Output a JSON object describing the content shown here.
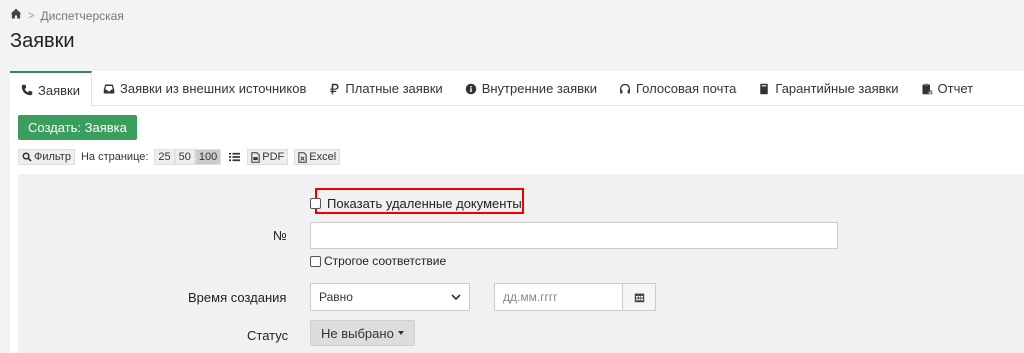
{
  "breadcrumb": {
    "home_icon": "home-icon",
    "separator": ">",
    "current": "Диспетчерская"
  },
  "page": {
    "title": "Заявки"
  },
  "tabs": [
    {
      "label": "Заявки",
      "icon": "phone-icon"
    },
    {
      "label": "Заявки из внешних источников",
      "icon": "inbox-icon"
    },
    {
      "label": "Платные заявки",
      "icon": "ruble-icon"
    },
    {
      "label": "Внутренние заявки",
      "icon": "info-icon"
    },
    {
      "label": "Голосовая почта",
      "icon": "headphones-icon"
    },
    {
      "label": "Гарантийные заявки",
      "icon": "book-icon"
    },
    {
      "label": "Отчет",
      "icon": "clipboard-icon"
    }
  ],
  "actions": {
    "create_label": "Создать: Заявка"
  },
  "toolbar": {
    "filter_label": "Фильтр",
    "per_page_label": "На странице:",
    "per_page_options": [
      "25",
      "50",
      "100"
    ],
    "per_page_selected": "100",
    "pdf_label": "PDF",
    "excel_label": "Excel"
  },
  "filters": {
    "show_deleted_label": "Показать удаленные документы",
    "number_label": "№",
    "number_value": "",
    "strict_label": "Строгое соответствие",
    "created_label": "Время создания",
    "created_operator": "Равно",
    "date_placeholder": "дд.мм.гггг",
    "status_label": "Статус",
    "status_value": "Не выбрано"
  },
  "colors": {
    "accent_green": "#3a9f5c",
    "highlight_red": "#e00000"
  }
}
